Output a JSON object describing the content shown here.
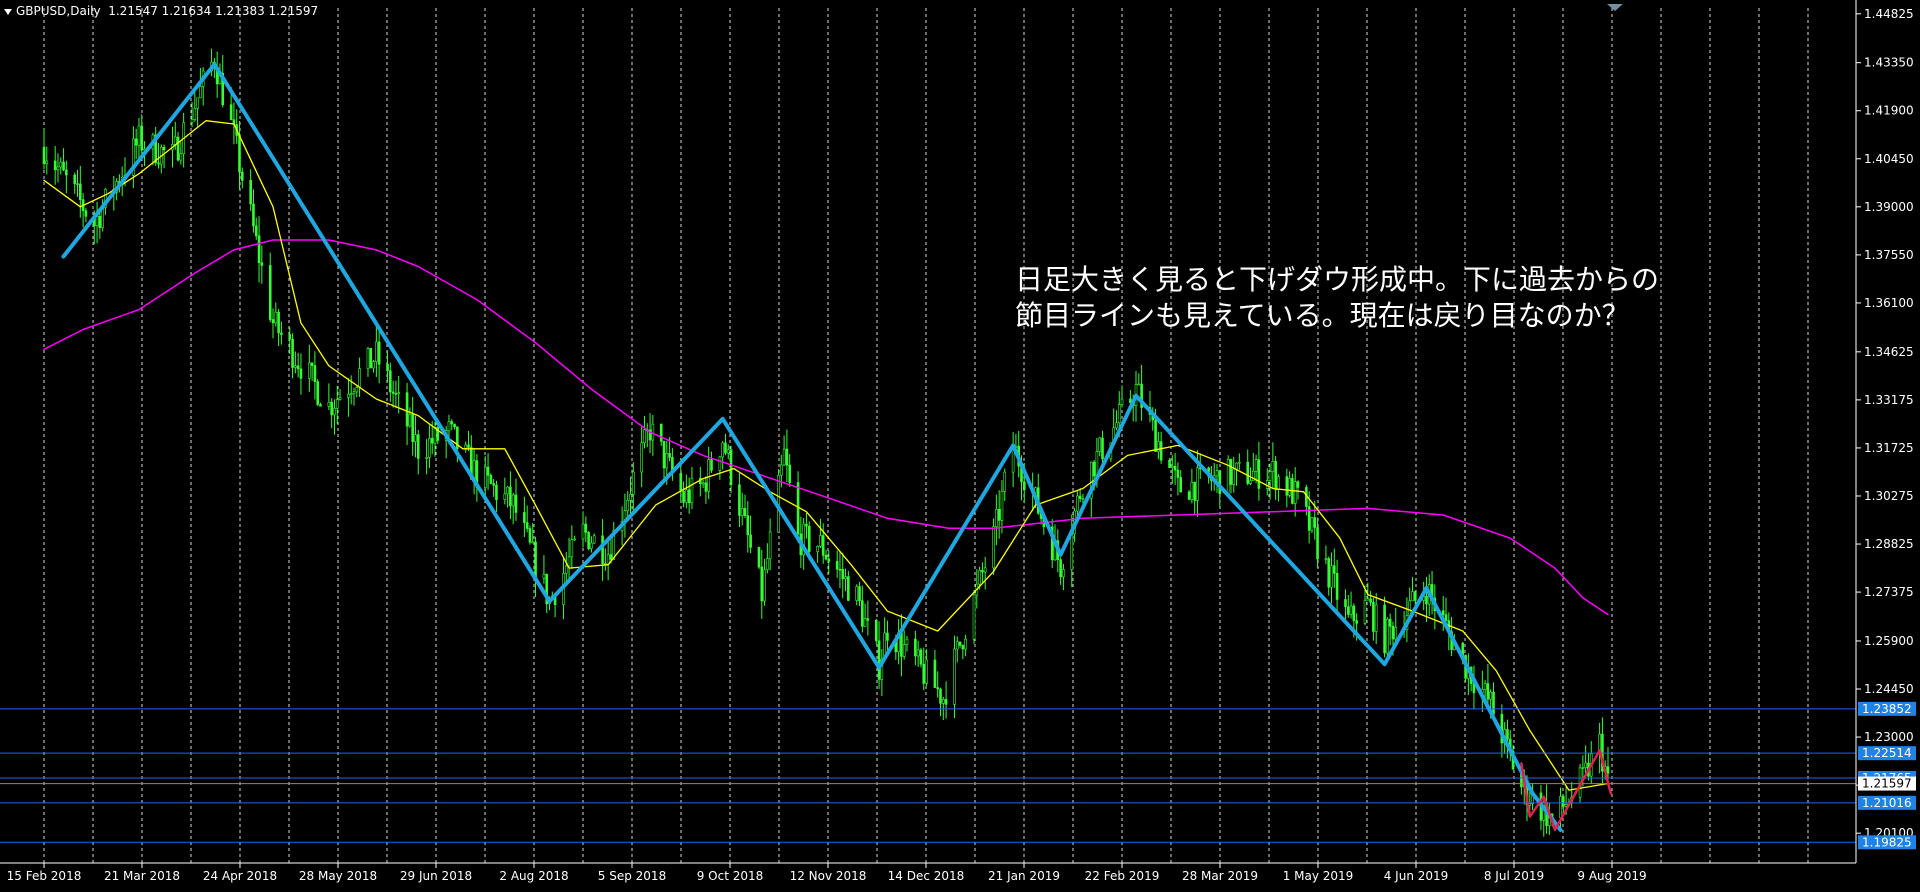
{
  "header": {
    "symbol": "GBPUSD,Daily",
    "ohlc": "1.21547 1.21634 1.21383 1.21597"
  },
  "annotation": {
    "line1": "日足大きく見ると下げダウ形成中。下に過去からの",
    "line2": "節目ラインも見えている。現在は戻り目なのか？"
  },
  "colors": {
    "background": "#000000",
    "grid": "#ffffff",
    "frame": "#ffffff",
    "candles": "#33ff33",
    "ma_fast": "#ffff00",
    "ma_slow": "#ff00ff",
    "dow_zigzag": "#1ea7e1",
    "recent_zigzag": "#e02050",
    "hlines": "#1e64ff",
    "price_badge": "#1e82e6"
  },
  "chart_data": {
    "type": "candlestick",
    "symbol": "GBPUSD",
    "timeframe": "Daily",
    "ylim": [
      1.192,
      1.45
    ],
    "date_range": [
      "2018-02-15",
      "2019-08-29"
    ],
    "y_ticks": [
      "1.44825",
      "1.43350",
      "1.41900",
      "1.40450",
      "1.39000",
      "1.37550",
      "1.36100",
      "1.34625",
      "1.33175",
      "1.31725",
      "1.30275",
      "1.28825",
      "1.27375",
      "1.25900",
      "1.24450",
      "1.23000",
      "1.21550",
      "1.20100"
    ],
    "x_ticks": [
      "15 Feb 2018",
      "21 Mar 2018",
      "24 Apr 2018",
      "28 May 2018",
      "29 Jun 2018",
      "2 Aug 2018",
      "5 Sep 2018",
      "9 Oct 2018",
      "12 Nov 2018",
      "14 Dec 2018",
      "21 Jan 2019",
      "22 Feb 2019",
      "28 Mar 2019",
      "1 May 2019",
      "4 Jun 2019",
      "8 Jul 2019",
      "9 Aug 2019"
    ],
    "price_path": [
      [
        "2018-02-15",
        1.408
      ],
      [
        "2018-03-05",
        1.385
      ],
      [
        "2018-03-21",
        1.41
      ],
      [
        "2018-04-02",
        1.405
      ],
      [
        "2018-04-17",
        1.435
      ],
      [
        "2018-04-24",
        1.411
      ],
      [
        "2018-05-08",
        1.355
      ],
      [
        "2018-05-28",
        1.33
      ],
      [
        "2018-06-14",
        1.345
      ],
      [
        "2018-06-29",
        1.317
      ],
      [
        "2018-07-10",
        1.322
      ],
      [
        "2018-07-20",
        1.309
      ],
      [
        "2018-08-02",
        1.3
      ],
      [
        "2018-08-15",
        1.271
      ],
      [
        "2018-08-27",
        1.292
      ],
      [
        "2018-09-05",
        1.286
      ],
      [
        "2018-09-20",
        1.323
      ],
      [
        "2018-10-02",
        1.302
      ],
      [
        "2018-10-09",
        1.306
      ],
      [
        "2018-10-16",
        1.32
      ],
      [
        "2018-10-30",
        1.273
      ],
      [
        "2018-11-07",
        1.315
      ],
      [
        "2018-11-12",
        1.29
      ],
      [
        "2018-11-20",
        1.288
      ],
      [
        "2018-12-03",
        1.272
      ],
      [
        "2018-12-11",
        1.252
      ],
      [
        "2018-12-14",
        1.263
      ],
      [
        "2019-01-03",
        1.242
      ],
      [
        "2019-01-21",
        1.29
      ],
      [
        "2019-01-28",
        1.318
      ],
      [
        "2019-02-14",
        1.282
      ],
      [
        "2019-02-22",
        1.307
      ],
      [
        "2019-03-13",
        1.335
      ],
      [
        "2019-03-28",
        1.305
      ],
      [
        "2019-04-15",
        1.309
      ],
      [
        "2019-05-01",
        1.31
      ],
      [
        "2019-05-10",
        1.302
      ],
      [
        "2019-05-28",
        1.265
      ],
      [
        "2019-06-04",
        1.27
      ],
      [
        "2019-06-10",
        1.26
      ],
      [
        "2019-06-25",
        1.275
      ],
      [
        "2019-07-08",
        1.253
      ],
      [
        "2019-07-18",
        1.24
      ],
      [
        "2019-07-29",
        1.215
      ],
      [
        "2019-08-09",
        1.205
      ],
      [
        "2019-08-12",
        1.208
      ],
      [
        "2019-08-20",
        1.217
      ],
      [
        "2019-08-26",
        1.228
      ],
      [
        "2019-08-29",
        1.216
      ]
    ],
    "ma_fast": [
      [
        "2018-02-15",
        1.398
      ],
      [
        "2018-02-28",
        1.39
      ],
      [
        "2018-03-10",
        1.394
      ],
      [
        "2018-03-21",
        1.4
      ],
      [
        "2018-04-02",
        1.408
      ],
      [
        "2018-04-14",
        1.416
      ],
      [
        "2018-04-24",
        1.415
      ],
      [
        "2018-05-08",
        1.39
      ],
      [
        "2018-05-18",
        1.355
      ],
      [
        "2018-05-28",
        1.342
      ],
      [
        "2018-06-14",
        1.332
      ],
      [
        "2018-06-29",
        1.327
      ],
      [
        "2018-07-15",
        1.317
      ],
      [
        "2018-07-30",
        1.317
      ],
      [
        "2018-08-10",
        1.3
      ],
      [
        "2018-08-22",
        1.281
      ],
      [
        "2018-09-05",
        1.282
      ],
      [
        "2018-09-22",
        1.3
      ],
      [
        "2018-10-09",
        1.308
      ],
      [
        "2018-10-20",
        1.311
      ],
      [
        "2018-11-02",
        1.304
      ],
      [
        "2018-11-15",
        1.298
      ],
      [
        "2018-12-01",
        1.282
      ],
      [
        "2018-12-14",
        1.268
      ],
      [
        "2019-01-01",
        1.262
      ],
      [
        "2019-01-21",
        1.28
      ],
      [
        "2019-02-05",
        1.3
      ],
      [
        "2019-02-22",
        1.305
      ],
      [
        "2019-03-10",
        1.315
      ],
      [
        "2019-03-28",
        1.318
      ],
      [
        "2019-04-15",
        1.312
      ],
      [
        "2019-05-01",
        1.305
      ],
      [
        "2019-05-12",
        1.304
      ],
      [
        "2019-05-25",
        1.29
      ],
      [
        "2019-06-04",
        1.273
      ],
      [
        "2019-06-20",
        1.268
      ],
      [
        "2019-07-08",
        1.262
      ],
      [
        "2019-07-20",
        1.25
      ],
      [
        "2019-08-01",
        1.232
      ],
      [
        "2019-08-15",
        1.214
      ],
      [
        "2019-08-29",
        1.216
      ]
    ],
    "ma_slow": [
      [
        "2018-02-15",
        1.347
      ],
      [
        "2018-03-01",
        1.353
      ],
      [
        "2018-03-21",
        1.359
      ],
      [
        "2018-04-10",
        1.37
      ],
      [
        "2018-04-24",
        1.377
      ],
      [
        "2018-05-08",
        1.38
      ],
      [
        "2018-05-28",
        1.38
      ],
      [
        "2018-06-14",
        1.377
      ],
      [
        "2018-06-29",
        1.372
      ],
      [
        "2018-07-20",
        1.362
      ],
      [
        "2018-08-10",
        1.349
      ],
      [
        "2018-08-30",
        1.335
      ],
      [
        "2018-09-20",
        1.322
      ],
      [
        "2018-10-09",
        1.315
      ],
      [
        "2018-10-30",
        1.309
      ],
      [
        "2018-11-20",
        1.303
      ],
      [
        "2018-12-14",
        1.296
      ],
      [
        "2019-01-05",
        1.293
      ],
      [
        "2019-01-21",
        1.293
      ],
      [
        "2019-02-22",
        1.296
      ],
      [
        "2019-03-28",
        1.297
      ],
      [
        "2019-05-01",
        1.298
      ],
      [
        "2019-06-04",
        1.299
      ],
      [
        "2019-07-01",
        1.297
      ],
      [
        "2019-07-25",
        1.29
      ],
      [
        "2019-08-10",
        1.281
      ],
      [
        "2019-08-20",
        1.272
      ],
      [
        "2019-08-29",
        1.267
      ]
    ],
    "zigzag_dow": [
      [
        "2018-02-22",
        1.375
      ],
      [
        "2018-04-17",
        1.433
      ],
      [
        "2018-08-15",
        1.271
      ],
      [
        "2018-10-16",
        1.326
      ],
      [
        "2018-12-11",
        1.251
      ],
      [
        "2019-01-28",
        1.318
      ],
      [
        "2019-02-14",
        1.285
      ],
      [
        "2019-03-13",
        1.333
      ],
      [
        "2019-06-10",
        1.252
      ],
      [
        "2019-06-25",
        1.275
      ],
      [
        "2019-08-02",
        1.213
      ],
      [
        "2019-08-12",
        1.202
      ]
    ],
    "zigzag_recent": [
      [
        "2019-07-29",
        1.222
      ],
      [
        "2019-08-01",
        1.206
      ],
      [
        "2019-08-06",
        1.212
      ],
      [
        "2019-08-10",
        1.202
      ],
      [
        "2019-08-26",
        1.226
      ],
      [
        "2019-08-30",
        1.213
      ]
    ],
    "hlines": [
      {
        "value": 1.23852,
        "label": "1.23852"
      },
      {
        "value": 1.22514,
        "label": "1.22514"
      },
      {
        "value": 1.21765,
        "label": "1.21765"
      },
      {
        "value": 1.21016,
        "label": "1.21016"
      },
      {
        "value": 1.19825,
        "label": "1.19825"
      }
    ],
    "current_price": {
      "value": 1.21597,
      "label": "1.21597"
    },
    "grid": true
  }
}
